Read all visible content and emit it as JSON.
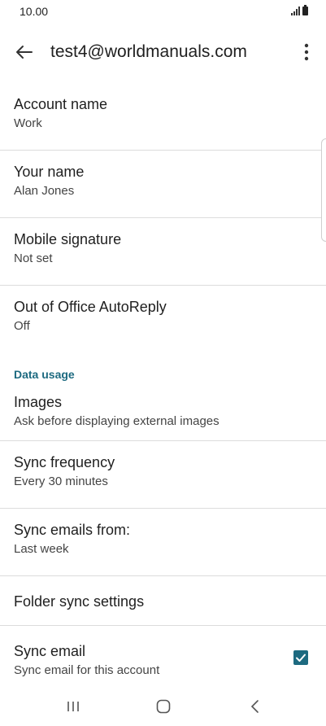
{
  "status_bar": {
    "time": "10.00"
  },
  "app_bar": {
    "title": "test4@worldmanuals.com",
    "back_icon": "arrow-left-icon",
    "more_icon": "more-vert-icon"
  },
  "settings": {
    "account_name": {
      "title": "Account name",
      "value": "Work"
    },
    "your_name": {
      "title": "Your name",
      "value": "Alan Jones"
    },
    "mobile_signature": {
      "title": "Mobile signature",
      "value": "Not set"
    },
    "out_of_office": {
      "title": "Out of Office AutoReply",
      "value": "Off"
    },
    "data_usage_header": "Data usage",
    "images": {
      "title": "Images",
      "value": "Ask before displaying external images"
    },
    "sync_frequency": {
      "title": "Sync frequency",
      "value": "Every 30 minutes"
    },
    "sync_emails_from": {
      "title": "Sync emails from:",
      "value": "Last week"
    },
    "folder_sync": {
      "title": "Folder sync settings"
    },
    "sync_email": {
      "title": "Sync email",
      "value": "Sync email for this account",
      "checked": true
    }
  },
  "colors": {
    "accent": "#1d6a80",
    "divider": "#dcdcdc"
  }
}
